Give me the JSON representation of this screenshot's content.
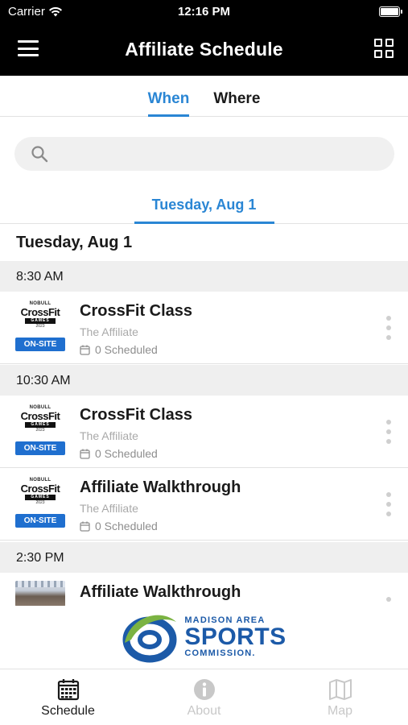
{
  "status_bar": {
    "carrier": "Carrier",
    "time": "12:16 PM"
  },
  "nav": {
    "title": "Affiliate Schedule"
  },
  "segments": [
    {
      "label": "When",
      "active": true
    },
    {
      "label": "Where",
      "active": false
    }
  ],
  "search": {
    "placeholder": "",
    "value": ""
  },
  "date_tab": {
    "label": "Tuesday, Aug 1"
  },
  "day_header": "Tuesday, Aug 1",
  "time_groups": [
    {
      "time": "8:30 AM",
      "events": [
        {
          "title": "CrossFit Class",
          "subtitle": "The Affiliate",
          "scheduled": "0 Scheduled",
          "thumb": "crossfit-games-onsite-logo"
        }
      ]
    },
    {
      "time": "10:30 AM",
      "events": [
        {
          "title": "CrossFit Class",
          "subtitle": "The Affiliate",
          "scheduled": "0 Scheduled",
          "thumb": "crossfit-games-onsite-logo"
        },
        {
          "title": "Affiliate Walkthrough",
          "subtitle": "The Affiliate",
          "scheduled": "0 Scheduled",
          "thumb": "crossfit-games-onsite-logo"
        }
      ]
    },
    {
      "time": "2:30 PM",
      "events": [
        {
          "title": "Affiliate Walkthrough",
          "thumb": "gym-photo"
        }
      ]
    }
  ],
  "crossfit_logo": {
    "brand_top": "NOBULL",
    "brand": "CrossFit",
    "games": "GAMES",
    "year": "2023",
    "badge": "ON-SITE"
  },
  "sponsor": {
    "line1": "MADISON AREA",
    "line2": "SPORTS",
    "line3": "COMMISSION."
  },
  "tabs": [
    {
      "label": "Schedule",
      "icon": "calendar-icon",
      "active": true
    },
    {
      "label": "About",
      "icon": "info-icon",
      "active": false
    },
    {
      "label": "Map",
      "icon": "map-icon",
      "active": false
    }
  ],
  "colors": {
    "accent": "#2a86d4",
    "onsite_badge": "#1f6fcf",
    "nav_bg": "#000000",
    "sponsor_blue": "#1c5aa8",
    "sponsor_green": "#7bb342"
  }
}
